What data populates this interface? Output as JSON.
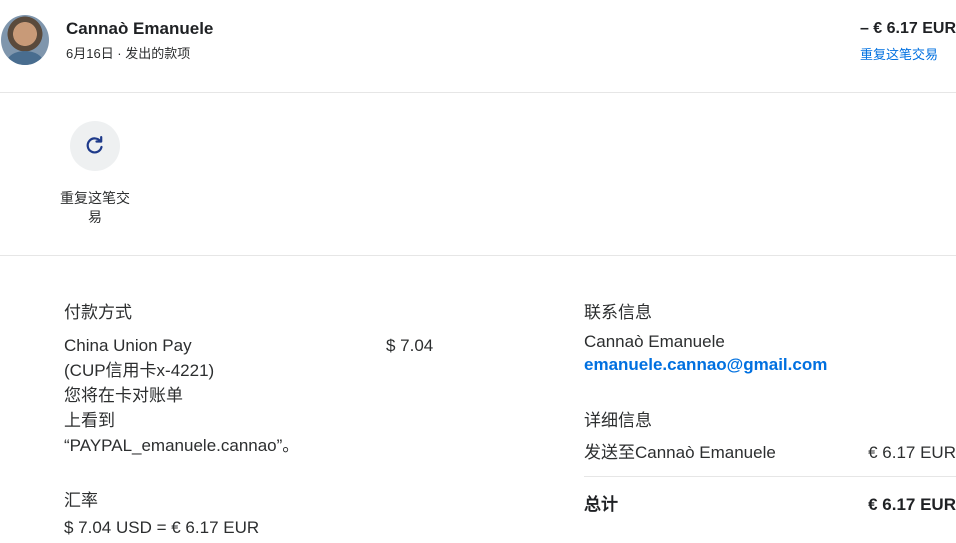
{
  "header": {
    "name": "Cannaò Emanuele",
    "subline": "6月16日 · 发出的款项",
    "amount": "– € 6.17 EUR",
    "repeat_link": "重复这笔交易"
  },
  "action": {
    "label": "重复这笔交易",
    "icon": "refresh-icon"
  },
  "payment": {
    "title": "付款方式",
    "method": "China Union Pay\n(CUP信用卡x-4221)\n您将在卡对账单\n上看到\n“PAYPAL_emanuele.cannao”。",
    "amount": "$ 7.04",
    "exchange_title": "汇率",
    "exchange_value": "$ 7.04 USD = € 6.17 EUR"
  },
  "contact": {
    "title": "联系信息",
    "name": "Cannaò Emanuele",
    "email": "emanuele.cannao@gmail.com"
  },
  "details": {
    "title": "详细信息",
    "sent_to_label": "发送至Cannaò Emanuele",
    "sent_to_value": "€ 6.17 EUR",
    "total_label": "总计",
    "total_value": "€ 6.17 EUR"
  },
  "colors": {
    "link": "#0070e0",
    "divider": "#e6e6e6",
    "action_bg": "#eef0f1",
    "icon": "#1e3a8a"
  }
}
